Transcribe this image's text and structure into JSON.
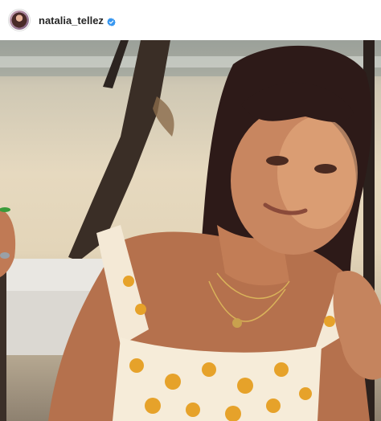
{
  "post": {
    "username": "natalia_tellez",
    "verified": true,
    "avatar_icon": "profile-avatar",
    "verified_icon": "verified-badge-icon",
    "accent_color": "#3897f0",
    "photo_subject": "photo"
  }
}
